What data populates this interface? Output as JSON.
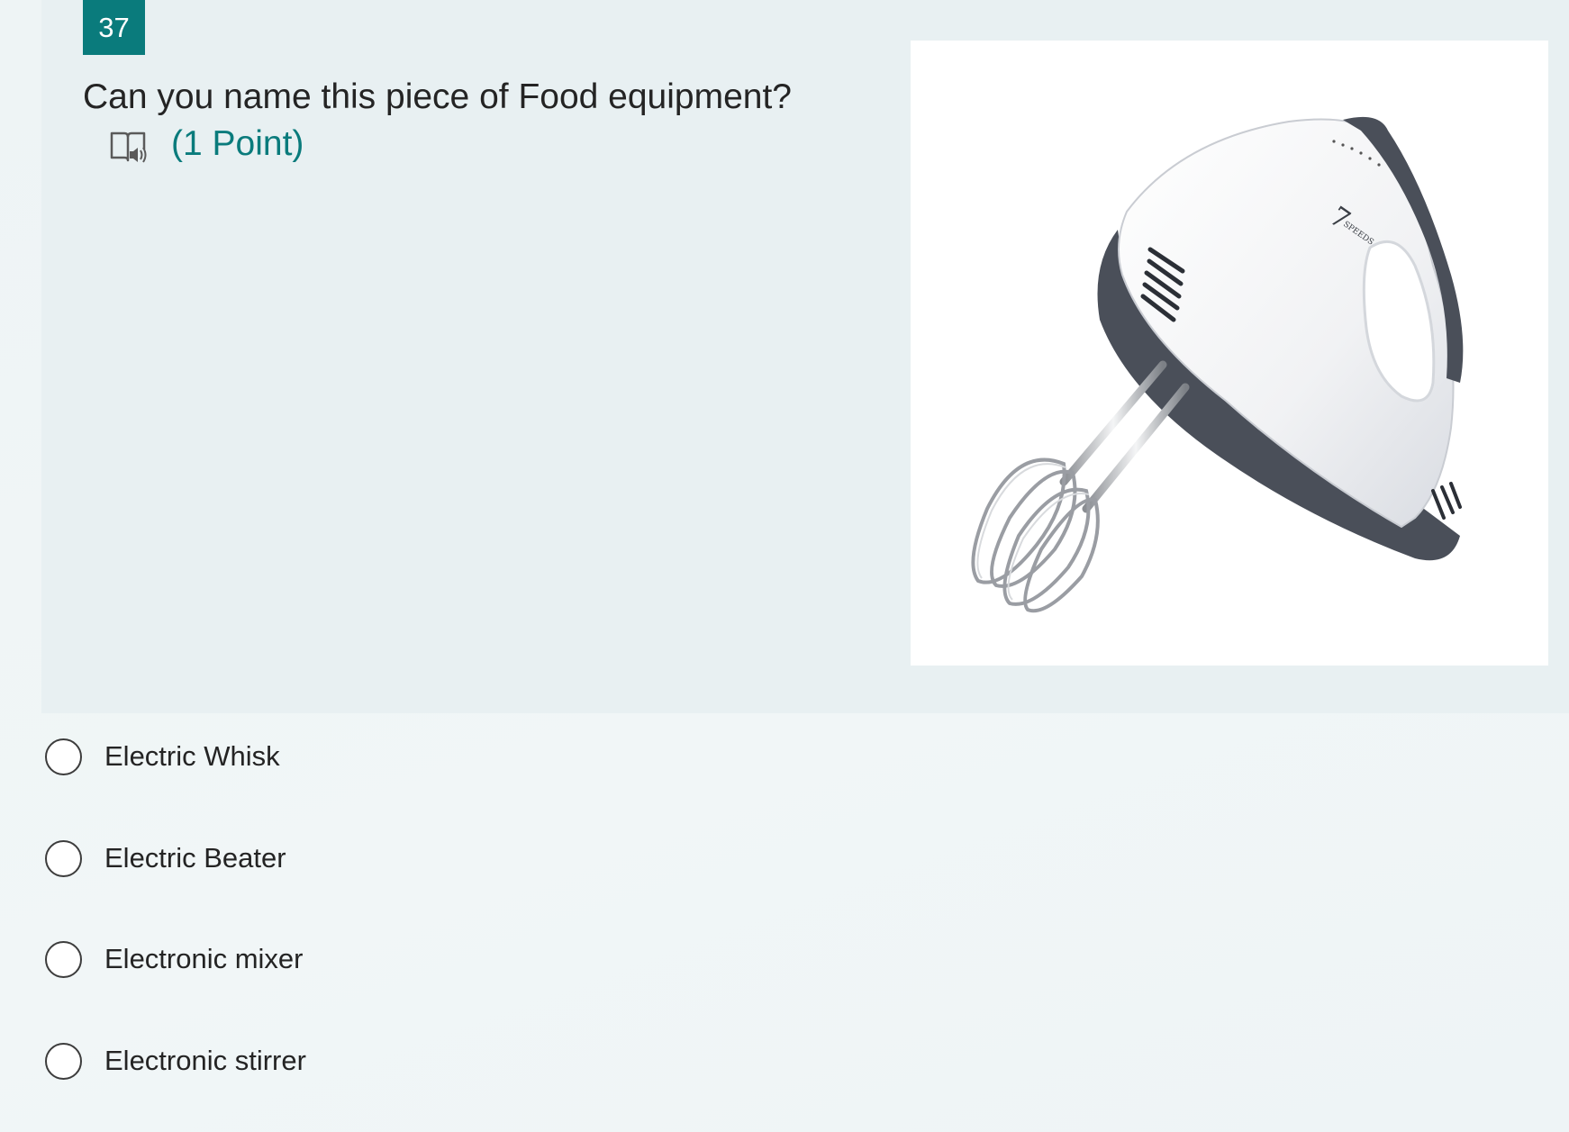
{
  "question": {
    "number": "37",
    "title": "Can you name this piece of Food equipment?",
    "points": "(1 Point)",
    "image_alt": "hand mixer"
  },
  "product_image": {
    "brand_number": "7",
    "brand_text": "SPEEDS"
  },
  "options": [
    {
      "label": "Electric Whisk",
      "selected": false
    },
    {
      "label": "Electric Beater",
      "selected": false
    },
    {
      "label": "Electronic mixer",
      "selected": false
    },
    {
      "label": "Electronic stirrer",
      "selected": false
    }
  ],
  "colors": {
    "accent": "#0a7b7c",
    "card_background": "#e8f0f2",
    "page_background": "#f0f5f6",
    "text": "#242424"
  },
  "icons": {
    "reader": "immersive-reader-icon",
    "radio": "radio-button-icon"
  }
}
